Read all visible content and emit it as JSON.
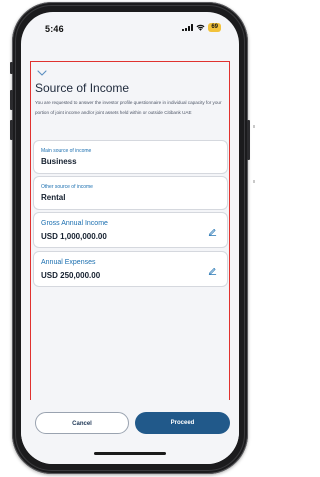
{
  "status_bar": {
    "time": "5:46",
    "battery": "69"
  },
  "page": {
    "title": "Source of Income",
    "description": "You are requested to answer the investor profile questionnaire in individual capacity for your portion of joint income and/or joint assets held within or outside Citibank UAE"
  },
  "fields": [
    {
      "label": "Main source of income",
      "value": "Business"
    },
    {
      "label": "Other source of income",
      "value": "Rental"
    },
    {
      "label": "Gross Annual Income",
      "value": "USD 1,000,000.00",
      "icon": "edit-pencil-icon"
    },
    {
      "label": "Annual Expenses",
      "value": "USD 250,000.00",
      "icon": "edit-pencil-icon"
    }
  ],
  "buttons": {
    "cancel": "Cancel",
    "proceed": "Proceed"
  },
  "colors": {
    "accent": "#1b6fb0",
    "primary_button": "#21598a",
    "highlight_border": "#e0322f",
    "battery": "#f2c23b"
  }
}
